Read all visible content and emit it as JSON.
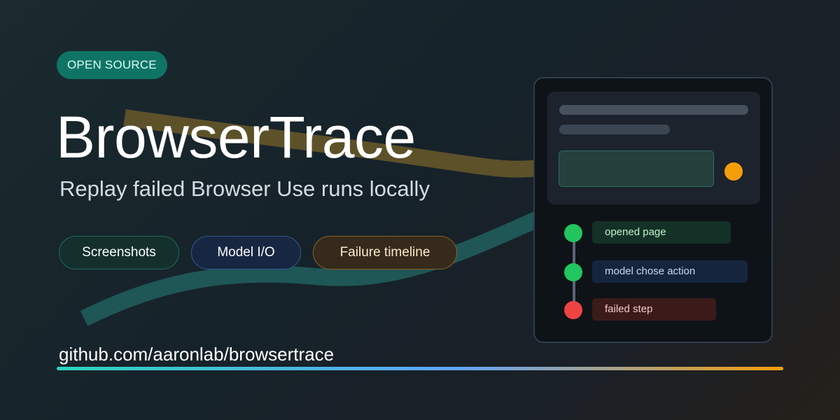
{
  "badge": {
    "label": "OPEN SOURCE"
  },
  "hero": {
    "title": "BrowserTrace",
    "subtitle": "Replay failed Browser Use runs locally"
  },
  "features": [
    {
      "label": "Screenshots"
    },
    {
      "label": "Model I/O"
    },
    {
      "label": "Failure timeline"
    }
  ],
  "repo": {
    "url": "github.com/aaronlab/browsertrace"
  },
  "timeline": {
    "steps": [
      {
        "label": "opened page",
        "status": "success"
      },
      {
        "label": "model chose action",
        "status": "success"
      },
      {
        "label": "failed step",
        "status": "failure"
      }
    ]
  },
  "colors": {
    "badge_bg": "#0f7466",
    "success": "#22c55e",
    "failure": "#ef4444",
    "accent_orange": "#f59e0b",
    "accent_teal": "#2dd4bf",
    "accent_blue": "#60a5fa"
  }
}
